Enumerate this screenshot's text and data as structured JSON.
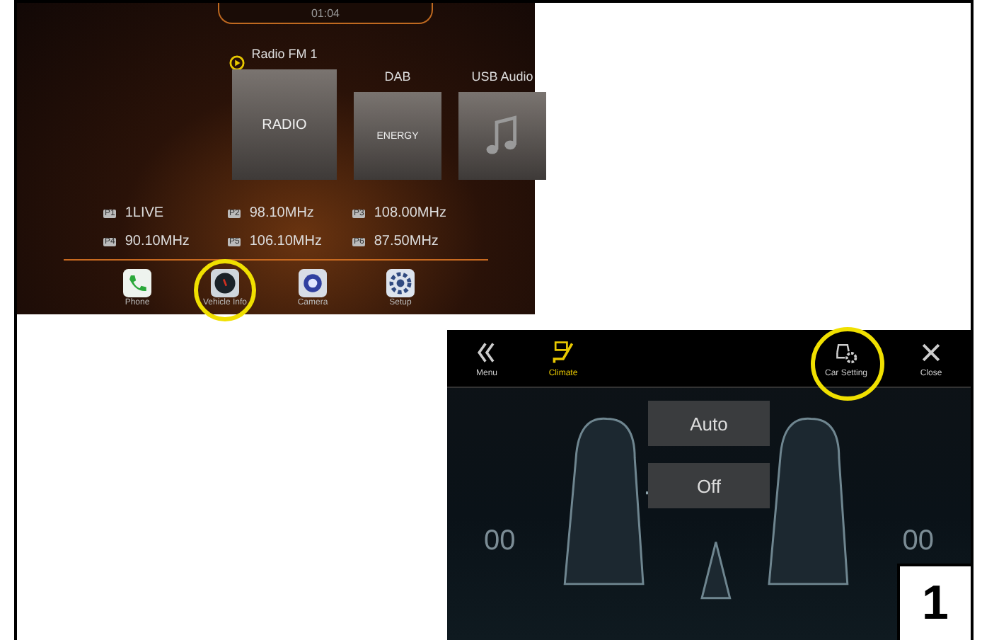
{
  "radio_screen": {
    "clock": "01:04",
    "sources": [
      {
        "label": "Radio FM 1",
        "kind": "radio",
        "tile_text": "RADIO",
        "playing": true
      },
      {
        "label": "DAB",
        "kind": "dab",
        "tile_text": "ENERGY",
        "playing": false
      },
      {
        "label": "USB Audio",
        "kind": "usb",
        "playing": false
      }
    ],
    "presets": [
      {
        "badge": "P1",
        "name": "1LIVE"
      },
      {
        "badge": "P2",
        "name": "98.10MHz"
      },
      {
        "badge": "P3",
        "name": "108.00MHz"
      },
      {
        "badge": "P4",
        "name": "90.10MHz"
      },
      {
        "badge": "P5",
        "name": "106.10MHz"
      },
      {
        "badge": "P6",
        "name": "87.50MHz"
      }
    ],
    "dock": [
      {
        "label": "Phone",
        "kind": "phone",
        "highlighted": false
      },
      {
        "label": "Vehicle Info",
        "kind": "vehicle",
        "highlighted": true
      },
      {
        "label": "Camera",
        "kind": "camera",
        "highlighted": false
      },
      {
        "label": "Setup",
        "kind": "setup",
        "highlighted": false
      }
    ]
  },
  "climate_screen": {
    "toolbar": [
      {
        "label": "Menu",
        "kind": "menu",
        "selected": false,
        "highlighted": false
      },
      {
        "label": "Climate",
        "kind": "climate",
        "selected": true,
        "highlighted": false
      },
      {
        "label": "Car Setting",
        "kind": "car-setting",
        "selected": false,
        "highlighted": true
      },
      {
        "label": "Close",
        "kind": "close",
        "selected": false,
        "highlighted": false
      }
    ],
    "buttons": [
      "Auto",
      "Off"
    ],
    "seat_levels": [
      "00",
      "00"
    ]
  },
  "step_number": "1"
}
